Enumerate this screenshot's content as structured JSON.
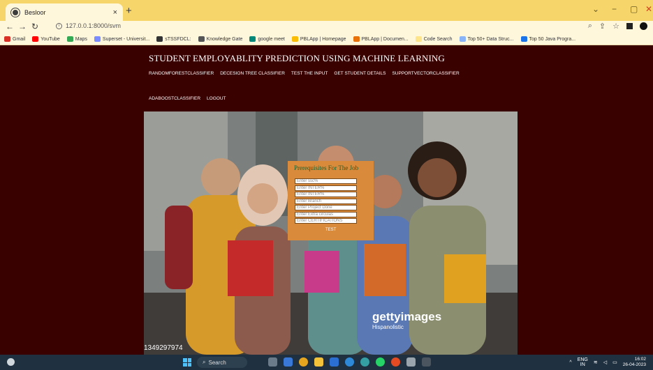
{
  "browser": {
    "tab_title": "Besloor",
    "tab_close": "×",
    "new_tab": "+",
    "url": "127.0.0.1:8000/svm",
    "bookmarks": [
      {
        "label": "Gmail",
        "color": "#d93025"
      },
      {
        "label": "YouTube",
        "color": "#ff0000"
      },
      {
        "label": "Maps",
        "color": "#34a853"
      },
      {
        "label": "Superset - Universit...",
        "color": "#7b8cff"
      },
      {
        "label": "sTSSFDCL:",
        "color": "#333333"
      },
      {
        "label": "Knowledge Gate",
        "color": "#555555"
      },
      {
        "label": "google meet",
        "color": "#00897b"
      },
      {
        "label": "PBLApp | Homepage",
        "color": "#fbbc04"
      },
      {
        "label": "PBLApp | Documen...",
        "color": "#e8710a"
      },
      {
        "label": "Code Search",
        "color": "#ffe58a"
      },
      {
        "label": "Top 50+ Data Struc...",
        "color": "#8ab4f8"
      },
      {
        "label": "Top 50 Java Progra...",
        "color": "#1a73e8"
      }
    ]
  },
  "site": {
    "title": "STUDENT EMPLOYABLITY PREDICTION USING MACHINE LEARNING",
    "nav_row1": [
      "RANDOMFORESTCLASSIFIER",
      "DECESION TREE CLASSIFIER",
      "TEST THE INPUT",
      "GET STUDENT DETAILS",
      "SUPPORTVECTORCLASSIFIER"
    ],
    "nav_row2": [
      "ADABOOSTCLASSIFIER",
      "LOGOUT"
    ]
  },
  "form": {
    "heading": "Prerequisites For The Job",
    "placeholders": [
      "Enter ssc%",
      "Enter INTER%",
      "Enter INTER%",
      "Enter Branch",
      "Enter Project Done",
      "Enter Extra circulas",
      "Enter CERTIFICATIONS"
    ],
    "submit_label": "TEST"
  },
  "image": {
    "watermark": "gettyimages",
    "watermark_sub": "Hispanolistic",
    "image_id": "1349297974"
  },
  "taskbar": {
    "search_label": "Search",
    "lang": "ENG",
    "region": "IN",
    "time": "16:02",
    "date": "26-04-2023"
  }
}
